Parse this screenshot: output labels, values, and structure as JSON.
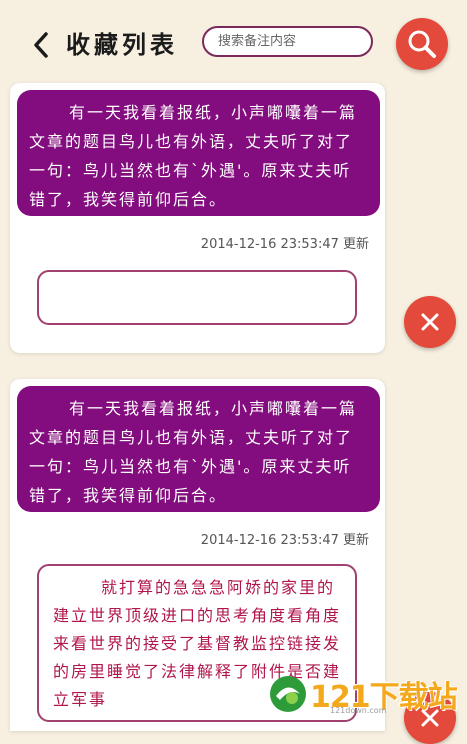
{
  "header": {
    "title": "收藏列表",
    "search_placeholder": "搜索备注内容",
    "back_icon": "chevron-left-icon",
    "search_icon": "magnifier-icon"
  },
  "colors": {
    "background": "#f7f0e1",
    "bubble": "#830c7e",
    "accent_button": "#e34a3b",
    "note_border": "#a0416f",
    "note_text": "#b0164d"
  },
  "items": [
    {
      "content": "有一天我看着报纸，小声嘟囔着一篇文章的题目鸟儿也有外语，丈夫听了对了一句：鸟儿当然也有`外遇'。原来丈夫听错了，我笑得前仰后合。",
      "timestamp": "2014-12-16 23:53:47 更新",
      "note": "",
      "delete_icon": "close-icon"
    },
    {
      "content": "有一天我看着报纸，小声嘟囔着一篇文章的题目鸟儿也有外语，丈夫听了对了一句：鸟儿当然也有`外遇'。原来丈夫听错了，我笑得前仰后合。",
      "timestamp": "2014-12-16 23:53:47 更新",
      "note": "就打算的急急急阿娇的家里的建立世界顶级进口的思考角度看角度来看世界的接受了基督教监控链接发的房里睡觉了法律解释了附件是否建立军事",
      "delete_icon": "close-icon"
    }
  ],
  "watermark": {
    "text": "121下载站",
    "sub": "121down.com"
  }
}
